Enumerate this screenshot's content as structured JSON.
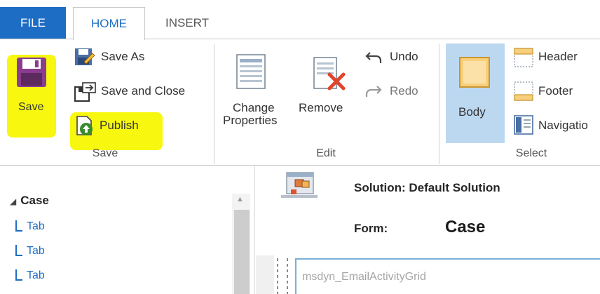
{
  "tabs": {
    "file": "FILE",
    "home": "HOME",
    "insert": "INSERT"
  },
  "ribbon": {
    "save_group": {
      "label": "Save",
      "save": "Save",
      "save_as": "Save As",
      "save_and_close": "Save and Close",
      "publish": "Publish"
    },
    "edit_group": {
      "label": "Edit",
      "change_properties_line1": "Change",
      "change_properties_line2": "Properties",
      "remove": "Remove",
      "undo": "Undo",
      "redo": "Redo"
    },
    "select_group": {
      "label": "Select",
      "body": "Body",
      "header": "Header",
      "footer": "Footer",
      "navigation": "Navigatio"
    }
  },
  "tree": {
    "root": "Case",
    "items": [
      "Tab",
      "Tab",
      "Tab"
    ]
  },
  "form": {
    "solution": "Solution: Default Solution",
    "form_label": "Form:",
    "form_name": "Case",
    "grid_name": "msdyn_EmailActivityGrid"
  },
  "colors": {
    "accent": "#1e6dc4",
    "highlight": "#f7f710",
    "selected": "#bcd8f0"
  }
}
